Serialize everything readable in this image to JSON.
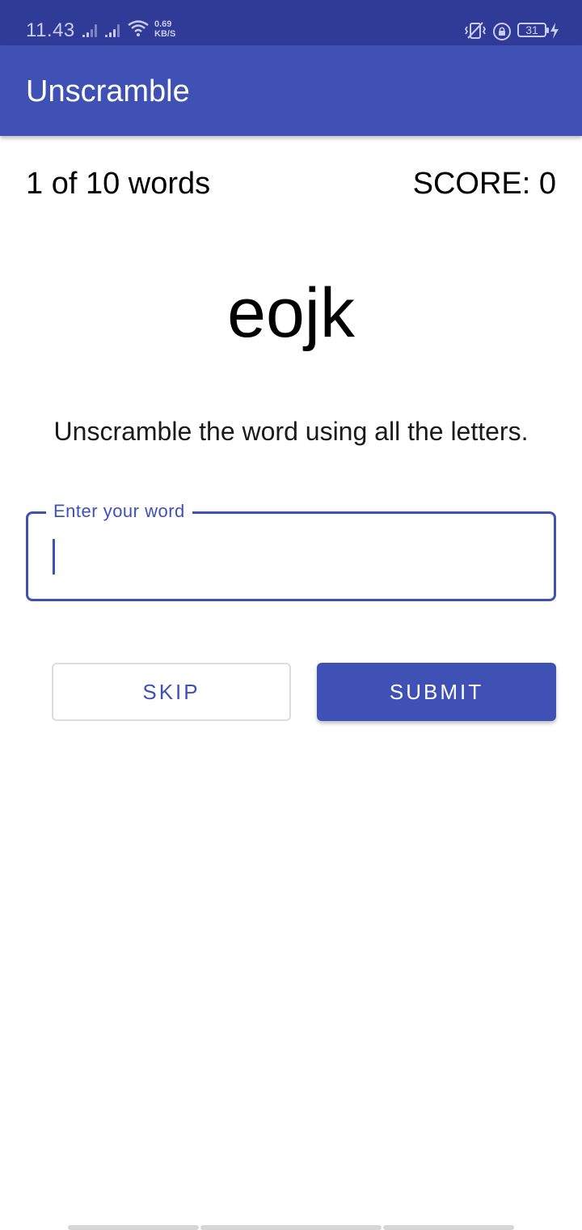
{
  "status_bar": {
    "time": "11.43",
    "net_speed_value": "0.69",
    "net_speed_unit": "KB/S",
    "battery_level": "31",
    "icons": [
      "signal-icon",
      "signal-icon",
      "wifi-icon",
      "vibrate-icon",
      "lock-rotation-icon",
      "battery-icon",
      "charging-icon"
    ]
  },
  "app_bar": {
    "title": "Unscramble",
    "color": "#3f51b5"
  },
  "game": {
    "word_count_text": "1 of 10 words",
    "score_text": "SCORE: 0",
    "scrambled_word": "eojk",
    "instructions": "Unscramble the word using all the letters."
  },
  "input": {
    "label": "Enter your word",
    "value": ""
  },
  "buttons": {
    "skip_label": "SKIP",
    "submit_label": "SUBMIT"
  }
}
